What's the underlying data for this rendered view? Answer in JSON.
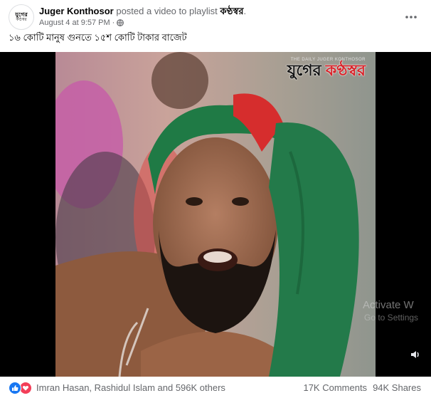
{
  "post": {
    "avatar_line1": "যুগের",
    "avatar_line2": "কণ্ঠস্বর",
    "author": "Juger Konthosor",
    "action": " posted a video to playlist ",
    "playlist": "কণ্ঠস্বর",
    "playlist_suffix": ".",
    "timestamp": "August 4 at 9:57 PM",
    "separator": "·",
    "privacy_icon": "globe-icon",
    "more_icon": "more-horizontal-icon",
    "text": "১৬ কোটি মানুষ গুনতে ১৫শ কোটি টাকার বাজেট"
  },
  "video": {
    "watermark_top": "THE DAILY JUGER KONTHOSOR",
    "watermark_main_1": "যুগের ",
    "watermark_main_2": "কণ্ঠস্বর",
    "volume_icon": "volume-icon",
    "background_color": "#000000"
  },
  "os_overlay": {
    "line1": "Activate W",
    "line2": "Go to Settings"
  },
  "footer": {
    "reactions": [
      "like-reaction-icon",
      "love-reaction-icon"
    ],
    "reactors_text": "Imran Hasan, Rashidul Islam and 596K others",
    "comments": "17K Comments",
    "shares": "94K Shares",
    "like_color": "#1877f2",
    "love_color": "#f33e58"
  }
}
